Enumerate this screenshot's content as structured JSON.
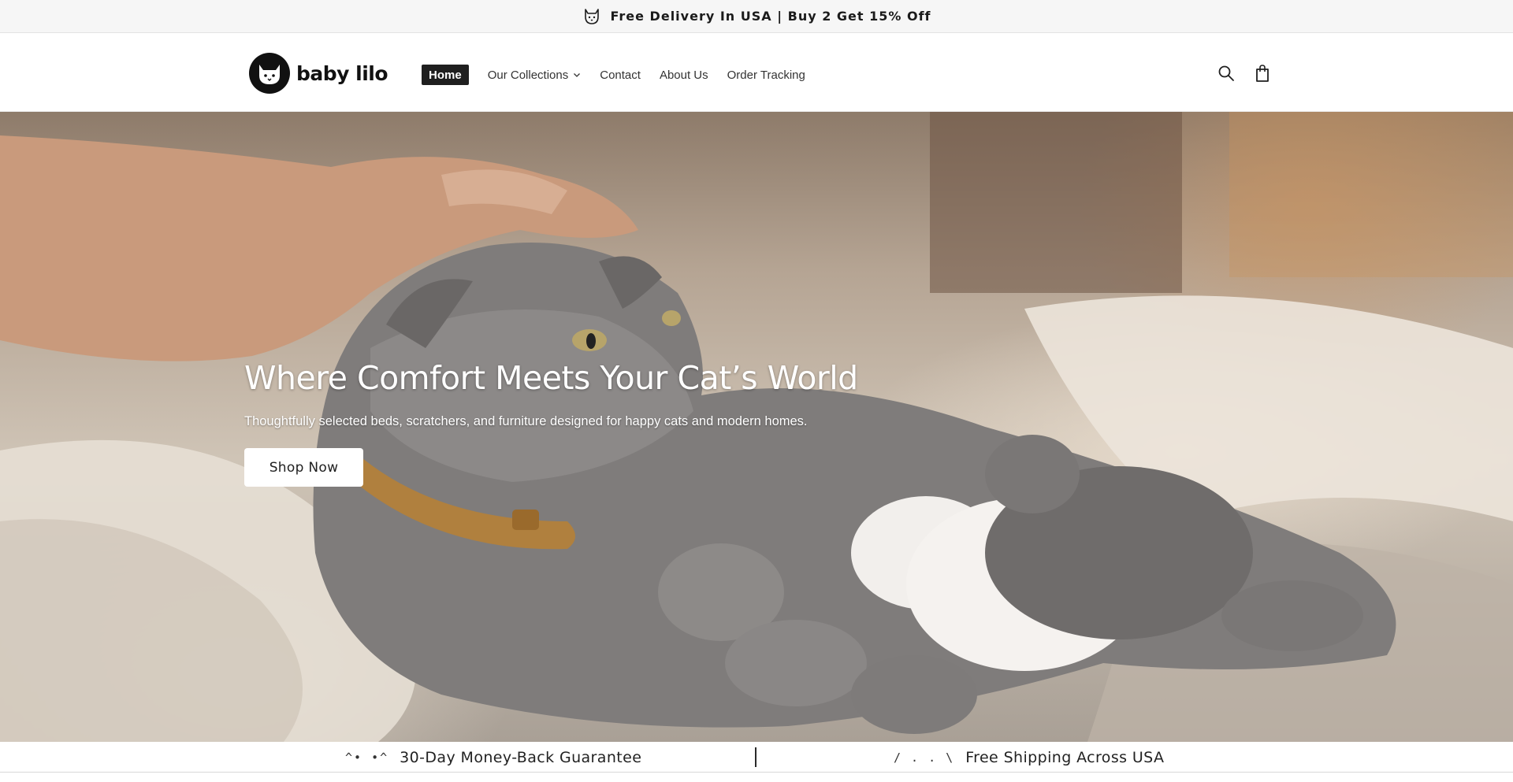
{
  "announcement": {
    "icon": "cat-icon",
    "text": "Free Delivery In USA | Buy 2 Get 15% Off"
  },
  "header": {
    "logo_text": "baby lilo",
    "nav": [
      {
        "label": "Home",
        "active": true
      },
      {
        "label": "Our Collections",
        "has_dropdown": true
      },
      {
        "label": "Contact"
      },
      {
        "label": "About Us"
      },
      {
        "label": "Order Tracking"
      }
    ],
    "icons": [
      "search-icon",
      "shopping-bag-icon"
    ]
  },
  "hero": {
    "title": "Where Comfort Meets Your Cat’s World",
    "subtitle": "Thoughtfully selected beds, scratchers, and furniture designed for happy cats and modern homes.",
    "cta_label": "Shop Now"
  },
  "marquee": {
    "items": [
      {
        "deco": "^• •^",
        "text": "30-Day Money-Back Guarantee"
      },
      {
        "deco": "/ .  . \\",
        "text": "Free Shipping Across USA"
      }
    ]
  },
  "colors": {
    "announcement_bg": "#f6f6f6",
    "active_nav_bg": "#1f1f1f",
    "button_bg": "#ffffff",
    "text_dark": "#1f1f1f"
  }
}
